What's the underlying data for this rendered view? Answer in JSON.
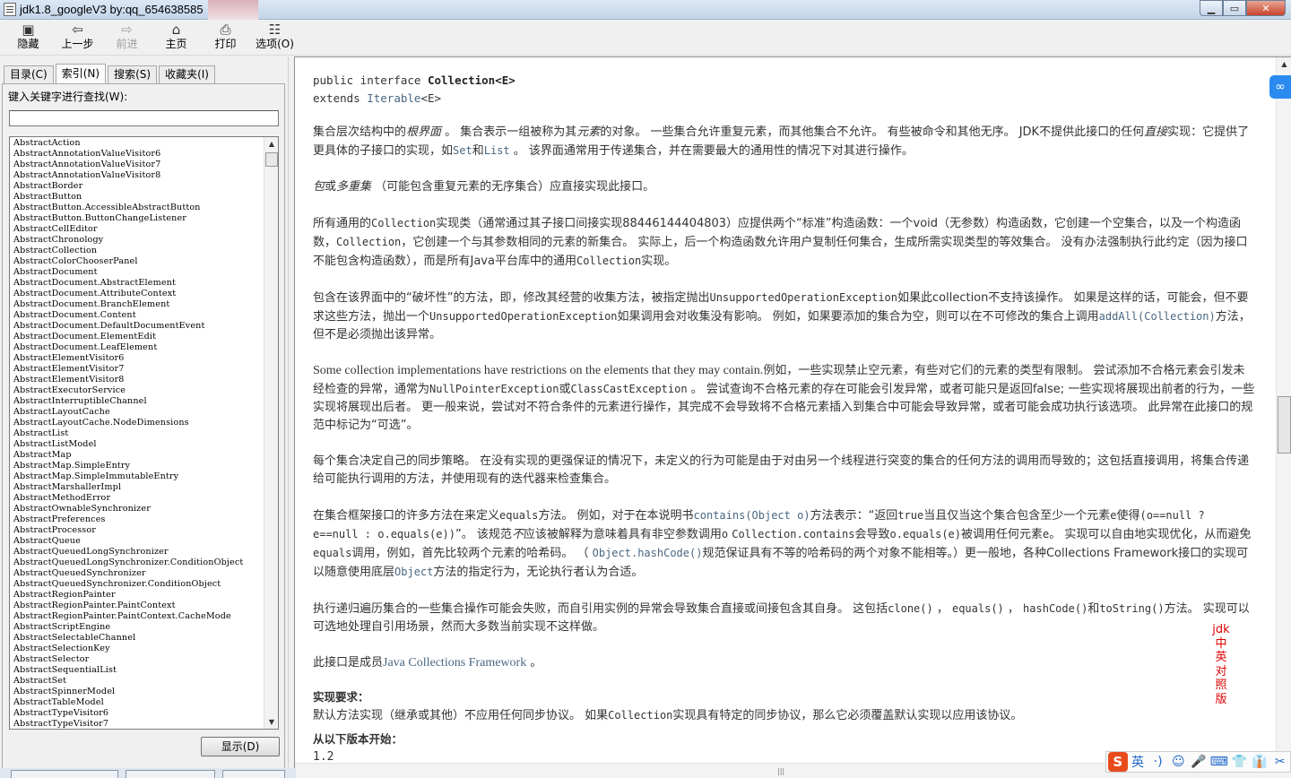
{
  "window": {
    "title": "jdk1.8_googleV3 by:qq_654638585",
    "min_label": "▁",
    "max_label": "▭",
    "close_label": "✕"
  },
  "toolbar": {
    "hide": "隐藏",
    "back": "上一步",
    "forward": "前进",
    "home": "主页",
    "print": "打印",
    "options": "选项(O)"
  },
  "tabs": {
    "contents": "目录(C)",
    "index": "索引(N)",
    "search": "搜索(S)",
    "favorites": "收藏夹(I)"
  },
  "index": {
    "keyword_label": "键入关键字进行查找(W):",
    "keyword_value": "",
    "show_button": "显示(D)",
    "items": [
      "AbstractAction",
      "AbstractAnnotationValueVisitor6",
      "AbstractAnnotationValueVisitor7",
      "AbstractAnnotationValueVisitor8",
      "AbstractBorder",
      "AbstractButton",
      "AbstractButton.AccessibleAbstractButton",
      "AbstractButton.ButtonChangeListener",
      "AbstractCellEditor",
      "AbstractChronology",
      "AbstractCollection",
      "AbstractColorChooserPanel",
      "AbstractDocument",
      "AbstractDocument.AbstractElement",
      "AbstractDocument.AttributeContext",
      "AbstractDocument.BranchElement",
      "AbstractDocument.Content",
      "AbstractDocument.DefaultDocumentEvent",
      "AbstractDocument.ElementEdit",
      "AbstractDocument.LeafElement",
      "AbstractElementVisitor6",
      "AbstractElementVisitor7",
      "AbstractElementVisitor8",
      "AbstractExecutorService",
      "AbstractInterruptibleChannel",
      "AbstractLayoutCache",
      "AbstractLayoutCache.NodeDimensions",
      "AbstractList",
      "AbstractListModel",
      "AbstractMap",
      "AbstractMap.SimpleEntry",
      "AbstractMap.SimpleImmutableEntry",
      "AbstractMarshallerImpl",
      "AbstractMethodError",
      "AbstractOwnableSynchronizer",
      "AbstractPreferences",
      "AbstractProcessor",
      "AbstractQueue",
      "AbstractQueuedLongSynchronizer",
      "AbstractQueuedLongSynchronizer.ConditionObject",
      "AbstractQueuedSynchronizer",
      "AbstractQueuedSynchronizer.ConditionObject",
      "AbstractRegionPainter",
      "AbstractRegionPainter.PaintContext",
      "AbstractRegionPainter.PaintContext.CacheMode",
      "AbstractScriptEngine",
      "AbstractSelectableChannel",
      "AbstractSelectionKey",
      "AbstractSelector",
      "AbstractSequentialList",
      "AbstractSet",
      "AbstractSpinnerModel",
      "AbstractTableModel",
      "AbstractTypeVisitor6",
      "AbstractTypeVisitor7"
    ]
  },
  "doc": {
    "sig_line1_prefix": "public interface ",
    "sig_name": "Collection<E>",
    "sig_extends": "extends ",
    "sig_iterable": "Iterable",
    "sig_generic": "<E>",
    "p1": {
      "a": "集合层次结构中的",
      "b": "根界面",
      "c": " 。 集合表示一组被称为其",
      "d": "元素",
      "e": "的对象。 一些集合允许重复元素，而其他集合不允许。 有些被命令和其他无序。 JDK不提供此接口的任何",
      "f": "直接",
      "g": "实现：它提供了更具体的子接口的实现，如",
      "h": "Set",
      "i": "和",
      "j": "List",
      "k": " 。 该界面通常用于传递集合，并在需要最大的通用性的情况下对其进行操作。"
    },
    "p2": {
      "a": "包",
      "b": "或",
      "c": "多重集",
      "d": " （可能包含重复元素的无序集合）应直接实现此接口。"
    },
    "p3": {
      "a": "所有通用的",
      "b": "Collection",
      "c": "实现类（通常通过其子接口间接实现88446144404803）应提供两个“标准”构造函数：一个void（无参数）构造函数，它创建一个空集合，以及一个构造函数，",
      "d": "Collection",
      "e": "，它创建一个与其参数相同的元素的新集合。 实际上，后一个构造函数允许用户复制任何集合，生成所需实现类型的等效集合。 没有办法强制执行此约定（因为接口不能包含构造函数），而是所有Java平台库中的通用",
      "f": "Collection",
      "g": "实现。"
    },
    "p4": {
      "a": "包含在该界面中的“破坏性”的方法，即，修改其经营的收集方法，被指定抛出",
      "b": "UnsupportedOperationException",
      "c": "如果此collection不支持该操作。 如果是这样的话，可能会，但不要求这些方法，抛出一个",
      "d": "UnsupportedOperationException",
      "e": "如果调用会对收集没有影响。 例如，如果要添加的集合为空，则可以在不可修改的集合上调用",
      "f": "addAll(Collection)",
      "g": "方法，但不是必须抛出该异常。"
    },
    "p5": {
      "a": "Some collection implementations have restrictions on the elements that they may contain.",
      "b": "例如，一些实现禁止空元素，有些对它们的元素的类型有限制。 尝试添加不合格元素会引发未经检查的异常，通常为",
      "c": "NullPointerException",
      "d": "或",
      "e": "ClassCastException",
      "f": " 。 尝试查询不合格元素的存在可能会引发异常，或者可能只是返回false; 一些实现将展现出前者的行为，一些实现将展现出后者。 更一般来说，尝试对不符合条件的元素进行操作，其完成不会导致将不合格元素插入到集合中可能会导致异常，或者可能会成功执行该选项。 此异常在此接口的规范中标记为“可选”。"
    },
    "p6": "每个集合决定自己的同步策略。 在没有实现的更强保证的情况下，未定义的行为可能是由于对由另一个线程进行突变的集合的任何方法的调用而导致的；这包括直接调用，将集合传递给可能执行调用的方法，并使用现有的迭代器来检查集合。",
    "p7": {
      "a": "在集合框架接口的许多方法在来定义",
      "b": "equals",
      "c": "方法。 例如，对于在本说明书",
      "d": "contains(Object o)",
      "e": "方法表示：“返回",
      "f": "true",
      "g": "当且仅当这个集合包含至少一个元素",
      "h": "e",
      "i": "使得",
      "j": "(o==null ? e==null : o.equals(e))",
      "k": "”。 该规范",
      "l": "不",
      "m": "应该被解释为意味着具有非空参数调用",
      "n": "o",
      "o": " ",
      "p": "Collection.contains",
      "q": "会导致",
      "r": "o.equals(e)",
      "s": "被调用任何元素",
      "t": "e",
      "u": "。 实现可以自由地实现优化，从而避免",
      "v": "equals",
      "w": "调用，例如，首先比较两个元素的哈希码。 （ ",
      "x": "Object.hashCode()",
      "y": "规范保证具有不等的哈希码的两个对象不能相等。）更一般地，各种Collections Framework接口的实现可以随意使用底层",
      "z": "Object",
      "z2": "方法的指定行为，无论执行者认为合适。"
    },
    "p8": {
      "a": "执行递归遍历集合的一些集合操作可能会失败，而自引用实例的异常会导致集合直接或间接包含其自身。 这包括",
      "b": "clone()",
      "c": " ， ",
      "d": "equals()",
      "e": " ， ",
      "f": "hashCode()",
      "g": "和",
      "h": "toString()",
      "i": "方法。 实现可以可选地处理自引用场景，然而大多数当前实现不这样做。"
    },
    "p9": {
      "a": "此接口是成员",
      "b": "Java Collections Framework",
      "c": " 。"
    },
    "impl_title": "实现要求：",
    "impl_body": {
      "a": "默认方法实现（继承或其他）不应用任何同步协议。 如果",
      "b": "Collection",
      "c": "实现具有特定的同步协议，那么它必须覆盖默认实现以应用该协议。"
    },
    "since_title": "从以下版本开始：",
    "since_value": "1.2",
    "red_note": [
      "jdk",
      "中",
      "英",
      "对",
      "照",
      "版"
    ]
  },
  "ime": {
    "lang": "英",
    "items": [
      "·)",
      "☺",
      "🎤",
      "⌨",
      "👕",
      "👔",
      "✂",
      "⚙"
    ]
  }
}
